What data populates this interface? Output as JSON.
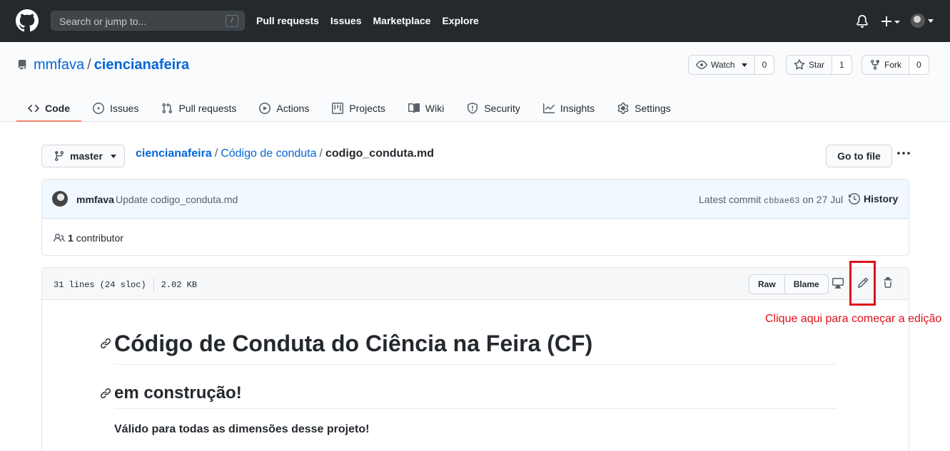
{
  "header": {
    "search_placeholder": "Search or jump to...",
    "search_shortcut": "/",
    "nav": [
      "Pull requests",
      "Issues",
      "Marketplace",
      "Explore"
    ]
  },
  "repo": {
    "owner": "mmfava",
    "separator": "/",
    "name": "ciencianafeira",
    "watch_label": "Watch",
    "watch_count": "0",
    "star_label": "Star",
    "star_count": "1",
    "fork_label": "Fork",
    "fork_count": "0",
    "tabs": [
      {
        "label": "Code",
        "icon": "code-icon"
      },
      {
        "label": "Issues",
        "icon": "issue-icon"
      },
      {
        "label": "Pull requests",
        "icon": "pull-request-icon"
      },
      {
        "label": "Actions",
        "icon": "play-icon"
      },
      {
        "label": "Projects",
        "icon": "project-icon"
      },
      {
        "label": "Wiki",
        "icon": "book-icon"
      },
      {
        "label": "Security",
        "icon": "shield-icon"
      },
      {
        "label": "Insights",
        "icon": "graph-icon"
      },
      {
        "label": "Settings",
        "icon": "gear-icon"
      }
    ]
  },
  "file_nav": {
    "branch": "master",
    "breadcrumb": {
      "root": "ciencianafeira",
      "folder": "Código de conduta",
      "file": "codigo_conduta.md",
      "sep": "/"
    },
    "go_to_file": "Go to file"
  },
  "commit": {
    "author": "mmfava",
    "message": "Update codigo_conduta.md",
    "latest_label": "Latest commit",
    "sha": "cbbae63",
    "date": "on 27 Jul",
    "history_label": "History",
    "contributors_count": "1",
    "contributors_label": "contributor"
  },
  "file": {
    "lines": "31 lines (24 sloc)",
    "size": "2.02 KB",
    "raw_label": "Raw",
    "blame_label": "Blame"
  },
  "annotation": {
    "hint": "Clique aqui para começar a edição",
    "color": "#e0111b"
  },
  "markdown": {
    "h1": "Código de Conduta do Ciência na Feira (CF)",
    "h2": "em construção!",
    "p": "Válido para todas as dimensões desse projeto!"
  }
}
